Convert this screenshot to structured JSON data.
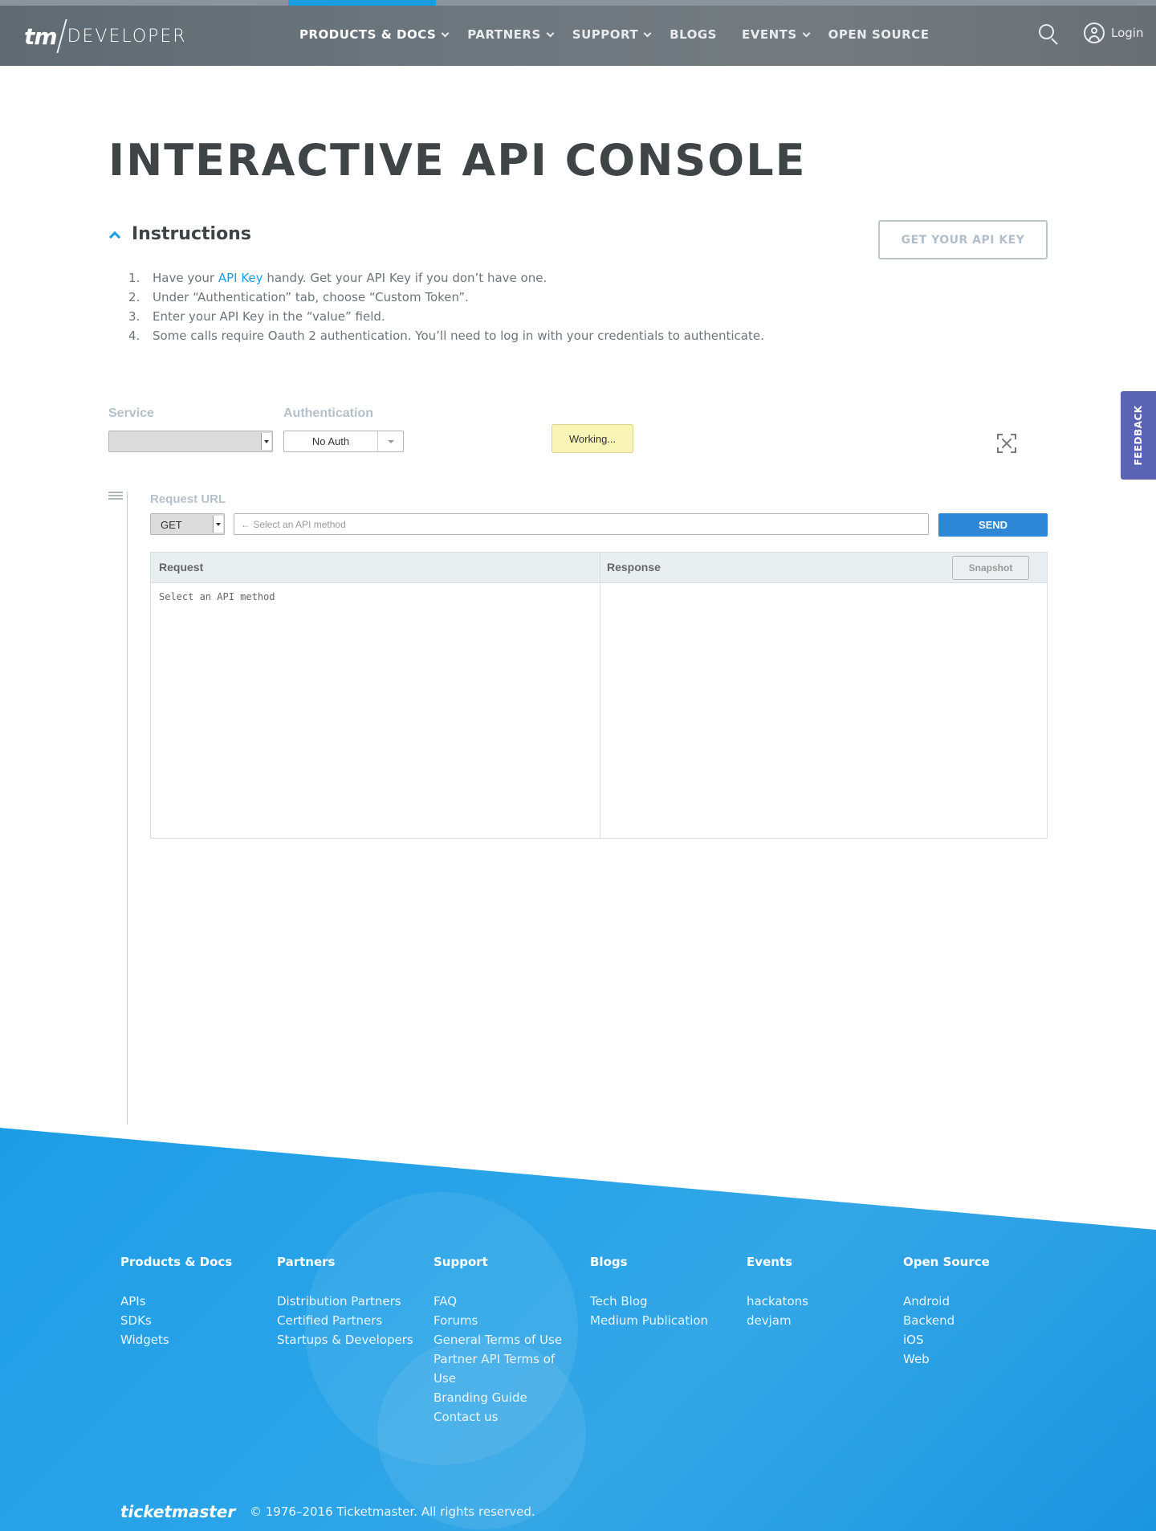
{
  "header": {
    "logo_tm": "tm",
    "logo_product": "DEVELOPER",
    "nav": [
      {
        "label": "PRODUCTS & DOCS",
        "has_dropdown": true,
        "active": true
      },
      {
        "label": "PARTNERS",
        "has_dropdown": true
      },
      {
        "label": "SUPPORT",
        "has_dropdown": true
      },
      {
        "label": "BLOGS",
        "has_dropdown": false
      },
      {
        "label": "EVENTS",
        "has_dropdown": true
      },
      {
        "label": "OPEN SOURCE",
        "has_dropdown": false
      }
    ],
    "search_icon": "search-icon",
    "login_label": "Login",
    "accent_color": "#1a9ce3"
  },
  "page": {
    "title": "INTERACTIVE API CONSOLE"
  },
  "instructions": {
    "title": "Instructions",
    "get_key_button": "GET YOUR API KEY",
    "items": [
      {
        "num": "1.",
        "pre": "Have your ",
        "link": "API Key",
        "post": " handy. Get your API Key if you don’t have one."
      },
      {
        "num": "2.",
        "pre": "Under “Authentication” tab, choose “Custom Token”."
      },
      {
        "num": "3.",
        "pre": "Enter your API Key in the “value” field."
      },
      {
        "num": "4.",
        "pre": "Some calls require Oauth 2 authentication. You’ll need to log in with your credentials to authenticate."
      }
    ]
  },
  "controls": {
    "service_label": "Service",
    "service_value": "",
    "auth_label": "Authentication",
    "auth_value": "No Auth",
    "status_text": "Working..."
  },
  "feedback_label": "FEEDBACK",
  "request": {
    "url_label": "Request URL",
    "method": "GET",
    "url_placeholder": "← Select an API method",
    "send_label": "SEND",
    "request_title": "Request",
    "response_title": "Response",
    "snapshot_label": "Snapshot",
    "request_body": "Select an API method"
  },
  "footer": {
    "columns": [
      {
        "title": "Products & Docs",
        "links": [
          "APIs",
          "SDKs",
          "Widgets"
        ]
      },
      {
        "title": "Partners",
        "links": [
          "Distribution Partners",
          "Certified Partners",
          "Startups & Developers"
        ]
      },
      {
        "title": "Support",
        "links": [
          "FAQ",
          "Forums",
          "General Terms of Use",
          "Partner API Terms of Use",
          "Branding Guide",
          "Contact us"
        ]
      },
      {
        "title": "Blogs",
        "links": [
          "Tech Blog",
          "Medium Publication"
        ]
      },
      {
        "title": "Events",
        "links": [
          "hackatons",
          "devjam"
        ]
      },
      {
        "title": "Open Source",
        "links": [
          "Android",
          "Backend",
          "iOS",
          "Web"
        ]
      }
    ],
    "brand": "ticketmaster",
    "copyright": "© 1976–2016 Ticketmaster. All rights reserved.",
    "background_color": "#1e9de6"
  }
}
